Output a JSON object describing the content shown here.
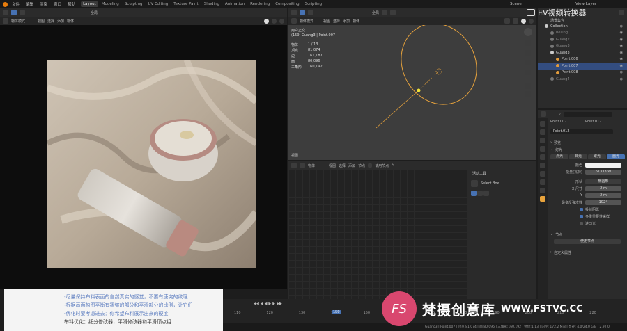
{
  "topbar": {
    "menus": [
      "文件",
      "编辑",
      "渲染",
      "窗口",
      "帮助"
    ],
    "workspaces": [
      "Layout",
      "Modeling",
      "Sculpting",
      "UV Editing",
      "Texture Paint",
      "Shading",
      "Animation",
      "Rendering",
      "Compositing",
      "Scripting"
    ],
    "active_workspace": "Layout",
    "scene": "Scene",
    "view_layer": "View Layer"
  },
  "left_header": {
    "mode": "物体模式",
    "items": [
      "视图",
      "选择",
      "添加",
      "物体"
    ],
    "global": "全局"
  },
  "viewport": {
    "mode": "物体模式",
    "items": [
      "视图",
      "选择",
      "添加",
      "物体"
    ],
    "global": "全局",
    "view_name": "用户正交",
    "collection_info": "(159) Guang3 | Point.007",
    "stats": [
      {
        "label": "物体",
        "value": "1 / 13"
      },
      {
        "label": "顶点",
        "value": "81,074"
      },
      {
        "label": "边",
        "value": "161,187"
      },
      {
        "label": "面",
        "value": "80,096"
      },
      {
        "label": "三角形",
        "value": "160,192"
      }
    ],
    "bottom_toggle": "视图"
  },
  "node_editor": {
    "mode": "物体",
    "items": [
      "视图",
      "选择",
      "添加",
      "节点"
    ],
    "use_nodes": "使用节点",
    "tool_panel_title": "活动工具",
    "select_box": "Select Box"
  },
  "outliner": {
    "title": "场景集合",
    "rows": [
      {
        "name": "Collection",
        "color": "#cccccc",
        "indent": 0,
        "selected": false
      },
      {
        "name": "Beiiing",
        "color": "#777777",
        "indent": 1,
        "selected": false
      },
      {
        "name": "Guang2",
        "color": "#777777",
        "indent": 1,
        "selected": false
      },
      {
        "name": "Guang3",
        "color": "#777777",
        "indent": 1,
        "selected": false
      },
      {
        "name": "Guang3",
        "color": "#cccccc",
        "indent": 1,
        "selected": false
      },
      {
        "name": "Point.006",
        "color": "#e39c3c",
        "indent": 2,
        "selected": false
      },
      {
        "name": "Point.007",
        "color": "#e39c3c",
        "indent": 2,
        "selected": true
      },
      {
        "name": "Point.008",
        "color": "#e39c3c",
        "indent": 2,
        "selected": false
      },
      {
        "name": "Guang4",
        "color": "#777777",
        "indent": 1,
        "selected": false
      }
    ]
  },
  "properties": {
    "object_name": "Point.007",
    "data_name": "Point.012",
    "data_field": "Point.012",
    "sections": {
      "preview": "预览",
      "light": "灯光",
      "nodes": "节点",
      "custom": "自定义属性"
    },
    "light_types": [
      "点光",
      "日光",
      "聚光",
      "面光"
    ],
    "active_light_type": "面光",
    "color_label": "颜色",
    "power_label": "能量(瓦特)",
    "power_value": "61333 W",
    "shape_label": "形状",
    "shape_value": "椭圆形",
    "sizex_label": "X 尺寸",
    "sizex_value": "2 m",
    "sizey_label": "Y",
    "sizey_value": "2 m",
    "bounces_label": "最多反弹次数",
    "bounces_value": "1024",
    "checks": [
      "投射阴影",
      "多重重要性采样",
      "进口光"
    ],
    "use_nodes_button": "使用节点"
  },
  "subtitles": {
    "lines": [
      "-尽量保持布料表面的自然真实的感觉，不要有唐突的纹理",
      "-根据画面构图平衡有褶皱的部分和平滑部分的比例，让它们",
      "-优化时要考虑进去：你希望布料展示出来的硬度",
      "布料优化：细分修改器，平滑修改器和平滑顶点组"
    ]
  },
  "timeline": {
    "ticks": [
      "110",
      "120",
      "130",
      "140",
      "150",
      "160",
      "170",
      "180",
      "190",
      "200",
      "210",
      "220"
    ],
    "current_frame": "159",
    "controls": [
      "◀◀",
      "◀",
      "◀",
      "▶",
      "▶",
      "▶▶"
    ]
  },
  "statusbar": {
    "text": "Guang3 | Point.007 | 顶点:81,074 | 面:80,096 | 三角形:160,192 | 物体:1/13 | 内存: 172.2 MiB | 显存: 4.0/24.0 GiB | 2.92.0"
  },
  "watermark_top": "EV视频转换器",
  "watermark_bottom": {
    "brand": "梵摄创意库",
    "url": "WWW.FSTVC.CC",
    "logo_letters": "FS"
  },
  "colors": {
    "accent": "#4772b3",
    "light_orange": "#e8a33c",
    "selection": "#334d80"
  }
}
